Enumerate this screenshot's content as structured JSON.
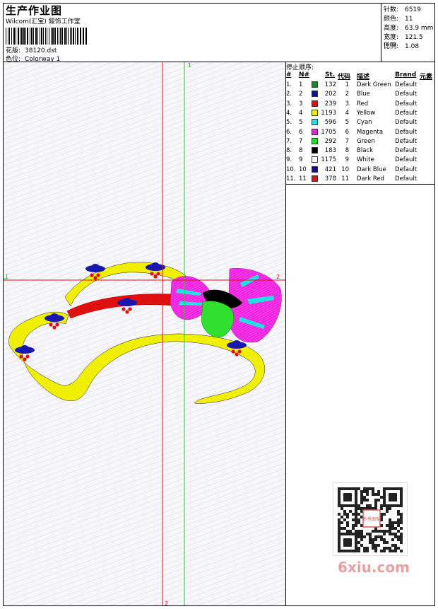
{
  "header": {
    "title": "生产作业图",
    "company": "Wilcom(汇宝) 錽饰工作室",
    "design_label": "花版:",
    "design_value": "38120.dst",
    "colorway_label": "色位:",
    "colorway_value": "Colorway 1"
  },
  "stats": [
    {
      "label": "针数:",
      "value": "6519"
    },
    {
      "label": "颜色:",
      "value": "11"
    },
    {
      "label": "高度:",
      "value": "63.9 mm"
    },
    {
      "label": "宽度:",
      "value": "121.5 mm"
    },
    {
      "label": "比例:",
      "value": "1.08"
    }
  ],
  "stop_sequence": {
    "title": "停止顺序:",
    "columns": {
      "idx": "#",
      "no": "N#",
      "st": "St.",
      "code": "代码",
      "desc": "描述",
      "brand": "Brand",
      "element": "元素"
    },
    "rows": [
      {
        "idx": "1.",
        "no": "1",
        "st": "132",
        "code": "1",
        "desc": "Dark Green",
        "brand": "Default",
        "color": "#1a8a2a"
      },
      {
        "idx": "2.",
        "no": "2",
        "st": "202",
        "code": "2",
        "desc": "Blue",
        "brand": "Default",
        "color": "#1010a0"
      },
      {
        "idx": "3.",
        "no": "3",
        "st": "239",
        "code": "3",
        "desc": "Red",
        "brand": "Default",
        "color": "#e01010"
      },
      {
        "idx": "4.",
        "no": "4",
        "st": "1193",
        "code": "4",
        "desc": "Yellow",
        "brand": "Default",
        "color": "#f0f000"
      },
      {
        "idx": "5.",
        "no": "5",
        "st": "596",
        "code": "5",
        "desc": "Cyan",
        "brand": "Default",
        "color": "#20e0e0"
      },
      {
        "idx": "6.",
        "no": "6",
        "st": "1705",
        "code": "6",
        "desc": "Magenta",
        "brand": "Default",
        "color": "#f020e0"
      },
      {
        "idx": "7.",
        "no": "7",
        "st": "292",
        "code": "7",
        "desc": "Green",
        "brand": "Default",
        "color": "#20e020"
      },
      {
        "idx": "8.",
        "no": "8",
        "st": "183",
        "code": "8",
        "desc": "Black",
        "brand": "Default",
        "color": "#000000"
      },
      {
        "idx": "9.",
        "no": "9",
        "st": "1175",
        "code": "9",
        "desc": "White",
        "brand": "Default",
        "color": "#ffffff"
      },
      {
        "idx": "10.",
        "no": "10",
        "st": "421",
        "code": "10",
        "desc": "Dark Blue",
        "brand": "Default",
        "color": "#101090"
      },
      {
        "idx": "11.",
        "no": "11",
        "st": "378",
        "code": "11",
        "desc": "Dark Red",
        "brand": "Default",
        "color": "#d01818"
      }
    ]
  },
  "guides": {
    "marker_1": "1",
    "marker_2": "2"
  },
  "watermark": "6xiu.com",
  "stamp_text": "秒秀图库"
}
